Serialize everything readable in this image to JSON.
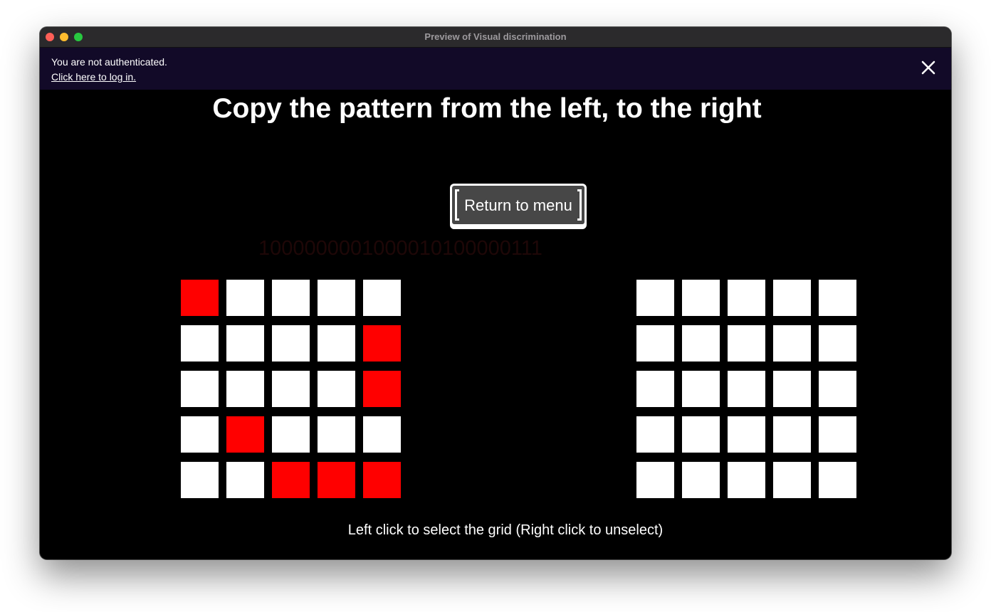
{
  "window": {
    "title": "Preview of Visual discrimination"
  },
  "auth": {
    "message": "You are not authenticated.",
    "login_link": "Click here to log in.",
    "close_icon": "close-icon"
  },
  "headline": "Copy the pattern from the left, to the right",
  "menu_button": {
    "label": "Return to menu"
  },
  "pattern_code": "1000000001000010100000111",
  "colors": {
    "selected": "#ff0000",
    "unselected": "#ffffff",
    "background": "#000000",
    "auth_bar": "#120a28"
  },
  "left_grid": {
    "rows": [
      [
        1,
        0,
        0,
        0,
        0
      ],
      [
        0,
        0,
        0,
        0,
        1
      ],
      [
        0,
        0,
        0,
        0,
        1
      ],
      [
        0,
        1,
        0,
        0,
        0
      ],
      [
        0,
        0,
        1,
        1,
        1
      ]
    ]
  },
  "right_grid": {
    "rows": [
      [
        0,
        0,
        0,
        0,
        0
      ],
      [
        0,
        0,
        0,
        0,
        0
      ],
      [
        0,
        0,
        0,
        0,
        0
      ],
      [
        0,
        0,
        0,
        0,
        0
      ],
      [
        0,
        0,
        0,
        0,
        0
      ]
    ]
  },
  "instructions": "Left click to select the grid (Right click to unselect)"
}
